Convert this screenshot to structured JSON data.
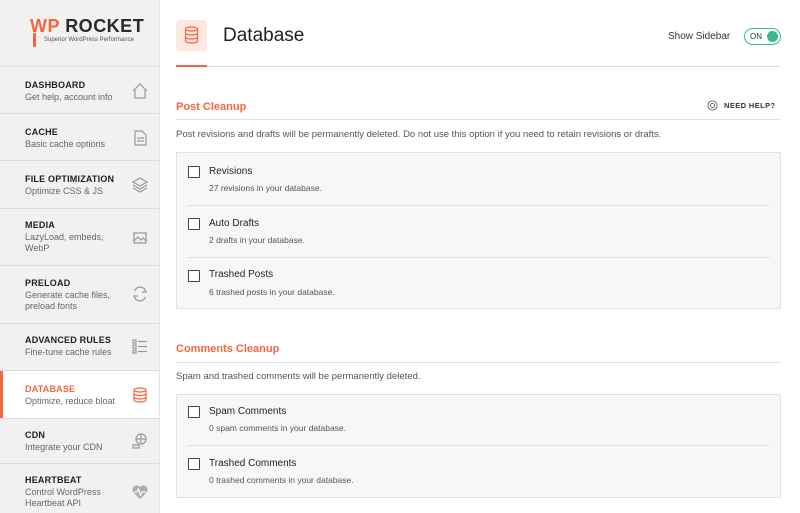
{
  "brand": {
    "logo_main_prefix": "WP",
    "logo_main_suffix": "ROCKET",
    "logo_tagline": "Superior WordPress Performance",
    "accent_color": "#f56640"
  },
  "sidebar": {
    "items": [
      {
        "title": "DASHBOARD",
        "desc": "Get help, account info",
        "icon": "home-icon"
      },
      {
        "title": "CACHE",
        "desc": "Basic cache options",
        "icon": "page-icon"
      },
      {
        "title": "FILE OPTIMIZATION",
        "desc": "Optimize CSS & JS",
        "icon": "layers-icon"
      },
      {
        "title": "MEDIA",
        "desc": "LazyLoad, embeds, WebP",
        "icon": "images-icon"
      },
      {
        "title": "PRELOAD",
        "desc": "Generate cache files, preload fonts",
        "icon": "refresh-icon"
      },
      {
        "title": "ADVANCED RULES",
        "desc": "Fine-tune cache rules",
        "icon": "list-icon"
      },
      {
        "title": "DATABASE",
        "desc": "Optimize, reduce bloat",
        "icon": "database-icon",
        "active": true
      },
      {
        "title": "CDN",
        "desc": "Integrate your CDN",
        "icon": "cdn-icon"
      },
      {
        "title": "HEARTBEAT",
        "desc": "Control WordPress Heartbeat API",
        "icon": "heartbeat-icon"
      }
    ]
  },
  "header": {
    "title": "Database",
    "show_sidebar_label": "Show Sidebar",
    "toggle_label": "ON",
    "toggle_color": "#3cb98a"
  },
  "post_cleanup": {
    "title": "Post Cleanup",
    "help_label": "NEED HELP?",
    "description": "Post revisions and drafts will be permanently deleted. Do not use this option if you need to retain revisions or drafts.",
    "options": [
      {
        "label": "Revisions",
        "desc": "27 revisions in your database."
      },
      {
        "label": "Auto Drafts",
        "desc": "2 drafts in your database."
      },
      {
        "label": "Trashed Posts",
        "desc": "6 trashed posts in your database."
      }
    ]
  },
  "comments_cleanup": {
    "title": "Comments Cleanup",
    "description": "Spam and trashed comments will be permanently deleted.",
    "options": [
      {
        "label": "Spam Comments",
        "desc": "0 spam comments in your database."
      },
      {
        "label": "Trashed Comments",
        "desc": "0 trashed comments in your database."
      }
    ]
  }
}
